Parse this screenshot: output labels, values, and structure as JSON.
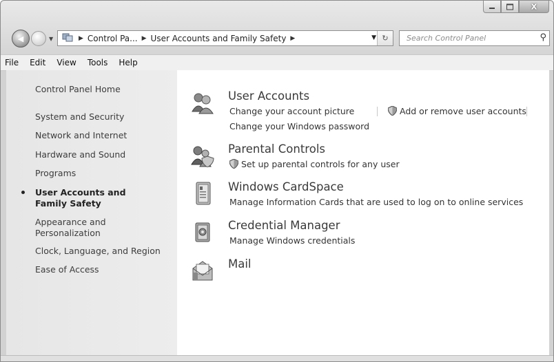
{
  "window": {
    "caption": {
      "minimize": "–",
      "maximize": "□",
      "close": "X"
    }
  },
  "nav": {
    "back_glyph": "◀",
    "breadcrumb": [
      "Control Pa...",
      "User Accounts and Family Safety"
    ],
    "refresh_glyph": "↻",
    "search_placeholder": "Search Control Panel",
    "search_glyph": "⚲"
  },
  "menu": [
    "File",
    "Edit",
    "View",
    "Tools",
    "Help"
  ],
  "sidebar": {
    "home": "Control Panel Home",
    "items": [
      "System and Security",
      "Network and Internet",
      "Hardware and Sound",
      "Programs",
      "User Accounts and Family Safety",
      "Appearance and Personalization",
      "Clock, Language, and Region",
      "Ease of Access"
    ],
    "current_index": 4
  },
  "categories": [
    {
      "title": "User Accounts",
      "icon": "users-icon",
      "links": [
        "Change your account picture",
        "Add or remove user accounts",
        "Change your Windows password"
      ]
    },
    {
      "title": "Parental Controls",
      "icon": "parental-controls-icon",
      "links": [
        "Set up parental controls for any user"
      ]
    },
    {
      "title": "Windows CardSpace",
      "icon": "cardspace-icon",
      "links": [
        "Manage Information Cards that are used to log on to online services"
      ]
    },
    {
      "title": "Credential Manager",
      "icon": "credential-manager-icon",
      "links": [
        "Manage Windows credentials"
      ]
    },
    {
      "title": "Mail",
      "icon": "mail-icon",
      "links": []
    }
  ]
}
